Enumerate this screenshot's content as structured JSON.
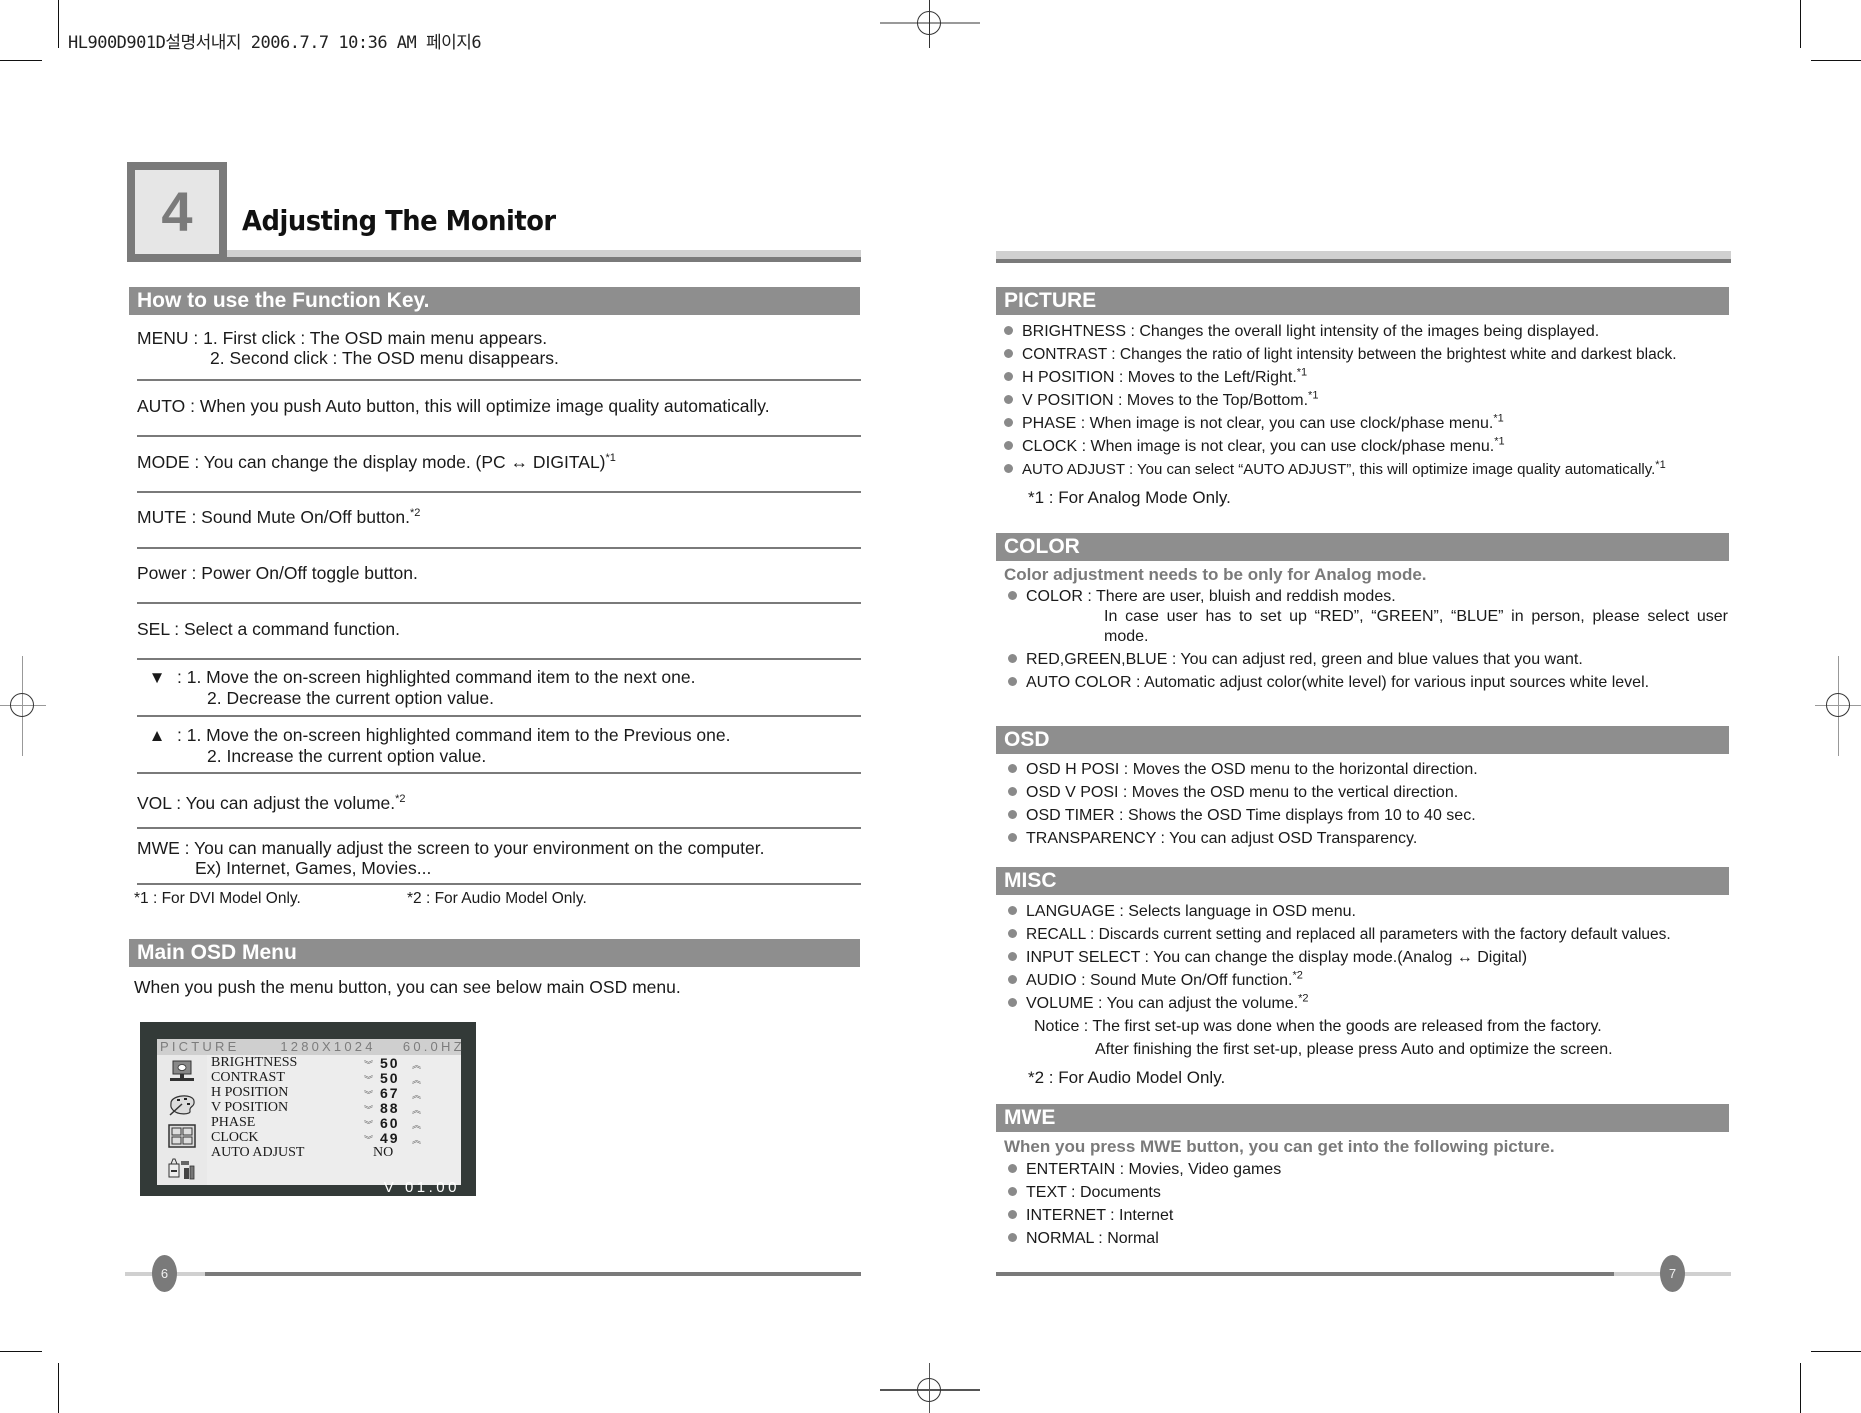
{
  "print_header": "HL900D901D설명서내지  2006.7.7 10:36 AM 페이지6",
  "chapter": {
    "number": "4",
    "title": "Adjusting The Monitor"
  },
  "left_page": {
    "function_key_section": {
      "title": "How to use the Function Key.",
      "rows": [
        {
          "key": "MENU",
          "lines": [
            "MENU : 1. First click : The OSD main menu appears.",
            "2. Second click : The OSD menu disappears."
          ]
        },
        {
          "key": "AUTO",
          "lines": [
            "AUTO :  When you push Auto button, this will optimize image quality automatically."
          ]
        },
        {
          "key": "MODE",
          "lines": [
            "MODE : You can change the display mode. (PC ↔ DIGITAL)"
          ],
          "footnote": "*1"
        },
        {
          "key": "MUTE",
          "lines": [
            "MUTE : Sound Mute On/Off button."
          ],
          "footnote": "*2"
        },
        {
          "key": "Power",
          "lines": [
            "Power : Power On/Off toggle button."
          ]
        },
        {
          "key": "SEL",
          "lines": [
            "SEL : Select a command function."
          ]
        },
        {
          "key": "down",
          "icon": "▼",
          "lines": [
            ": 1. Move the on-screen highlighted command item to the next one.",
            "2. Decrease the current option value."
          ]
        },
        {
          "key": "up",
          "icon": "▲",
          "lines": [
            ": 1. Move the on-screen highlighted command item to the Previous one.",
            "2. Increase the current option value."
          ]
        },
        {
          "key": "VOL",
          "lines": [
            "VOL  : You can adjust the volume."
          ],
          "footnote": "*2"
        },
        {
          "key": "MWE",
          "lines": [
            "MWE : You can manually adjust the screen to your environment on the computer.",
            "Ex) Internet, Games, Movies..."
          ]
        }
      ],
      "footnotes": [
        "*1 : For DVI Model Only.",
        "*2 : For Audio Model Only."
      ]
    },
    "osd_section": {
      "title": "Main OSD Menu",
      "intro": "When you push the menu button, you can see below main OSD menu.",
      "screen": {
        "header": "PICTURE      1280X1024    60.0HZ",
        "items": [
          {
            "label": "BRIGHTNESS",
            "value": "50"
          },
          {
            "label": "CONTRAST",
            "value": "50"
          },
          {
            "label": "H POSITION",
            "value": "67"
          },
          {
            "label": "V POSITION",
            "value": "88"
          },
          {
            "label": "PHASE",
            "value": "60"
          },
          {
            "label": "CLOCK",
            "value": "49"
          },
          {
            "label": "AUTO ADJUST",
            "value": "NO"
          }
        ],
        "down_glyph": "≫",
        "up_glyph": "≪",
        "version": "V 01.00",
        "side_icons": [
          "monitor-icon",
          "palette-icon",
          "osd-layout-icon",
          "misc-tools-icon"
        ]
      }
    },
    "page_number": "6"
  },
  "right_page": {
    "picture": {
      "title": "PICTURE",
      "items": [
        {
          "text": "BRIGHTNESS : Changes the overall light intensity of the images being displayed.",
          "footnote": ""
        },
        {
          "text": "CONTRAST : Changes the ratio of light intensity between the brightest white and darkest black.",
          "footnote": ""
        },
        {
          "text": "H POSITION : Moves to the Left/Right.",
          "footnote": "*1"
        },
        {
          "text": "V POSITION : Moves to the Top/Bottom.",
          "footnote": "*1"
        },
        {
          "text": "PHASE : When image is not clear, you can use clock/phase menu.",
          "footnote": "*1"
        },
        {
          "text": "CLOCK : When image is not clear, you can use clock/phase menu.",
          "footnote": "*1"
        },
        {
          "text": "AUTO ADJUST : You can select  “AUTO ADJUST”, this will optimize image quality automatically.",
          "footnote": "*1"
        }
      ],
      "note": "*1 : For Analog Mode Only."
    },
    "color": {
      "title": "COLOR",
      "intro": "Color adjustment needs to be only for Analog mode.",
      "items": [
        {
          "text": "COLOR : There are user, bluish and reddish modes.",
          "sub": "In case user has to set up  “RED”,  “GREEN”,  “BLUE”  in person, please select user mode."
        },
        {
          "text": "RED,GREEN,BLUE : You can adjust red, green and blue values that you want."
        },
        {
          "text": "AUTO COLOR : Automatic adjust color(white level) for various input sources white level."
        }
      ]
    },
    "osd": {
      "title": "OSD",
      "items": [
        "OSD H POSI : Moves the OSD menu to the horizontal direction.",
        "OSD V POSI : Moves the OSD menu to the vertical direction.",
        "OSD TIMER : Shows the OSD Time displays from 10 to 40 sec.",
        "TRANSPARENCY : You can adjust OSD Transparency."
      ]
    },
    "misc": {
      "title": "MISC",
      "items": [
        {
          "text": "LANGUAGE : Selects language in OSD menu.",
          "footnote": ""
        },
        {
          "text": "RECALL : Discards current setting and replaced all parameters with the factory default values.",
          "footnote": ""
        },
        {
          "text": "INPUT SELECT :  You can change the display mode.(Analog ↔ Digital)",
          "footnote": ""
        },
        {
          "text": "AUDIO : Sound Mute On/Off function.",
          "footnote": "*2"
        },
        {
          "text": "VOLUME : You can adjust the volume.",
          "footnote": "*2"
        }
      ],
      "notice_line1": "Notice : The first set-up was done when the goods are released from the factory.",
      "notice_line2": "After finishing the first set-up, please press Auto and optimize the screen.",
      "note": "*2 : For Audio Model Only."
    },
    "mwe": {
      "title": "MWE",
      "intro": "When you press MWE button, you can get into the following picture.",
      "items": [
        "ENTERTAIN : Movies, Video games",
        "TEXT : Documents",
        "INTERNET : Internet",
        "NORMAL : Normal"
      ]
    },
    "page_number": "7"
  }
}
